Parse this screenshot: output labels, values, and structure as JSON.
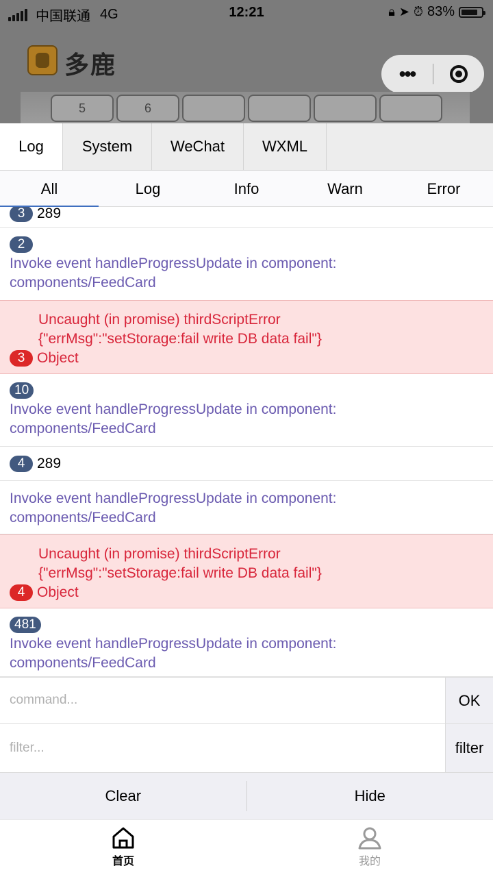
{
  "status_bar": {
    "carrier": "中国联通",
    "network": "4G",
    "time": "12:21",
    "battery_pct": "83%",
    "battery_level": 0.83
  },
  "app": {
    "title": "多鹿"
  },
  "photo_keys": [
    "5",
    "6"
  ],
  "console": {
    "tabs": [
      "Log",
      "System",
      "WeChat",
      "WXML"
    ],
    "active_tab": "Log",
    "subtabs": [
      "All",
      "Log",
      "Info",
      "Warn",
      "Error"
    ],
    "active_subtab": "All",
    "entries": [
      {
        "type": "log",
        "badge": "3",
        "text": "289"
      },
      {
        "type": "info",
        "badge": "2",
        "lines": [
          "Invoke event handleProgressUpdate in component:",
          "components/FeedCard"
        ]
      },
      {
        "type": "error",
        "badge": "3",
        "lines": [
          "Uncaught (in promise) thirdScriptError",
          "{\"errMsg\":\"setStorage:fail write DB data fail\"}",
          "Object"
        ]
      },
      {
        "type": "info",
        "badge": "10",
        "lines": [
          "Invoke event handleProgressUpdate in component:",
          "components/FeedCard"
        ]
      },
      {
        "type": "log",
        "badge": "4",
        "text": "289"
      },
      {
        "type": "info",
        "lines": [
          "Invoke event handleProgressUpdate in component:",
          "components/FeedCard"
        ]
      },
      {
        "type": "error",
        "badge": "4",
        "lines": [
          "Uncaught (in promise) thirdScriptError",
          "{\"errMsg\":\"setStorage:fail write DB data fail\"}",
          "Object"
        ]
      },
      {
        "type": "info",
        "badge": "481",
        "lines": [
          "Invoke event handleProgressUpdate in component:",
          "components/FeedCard"
        ]
      }
    ],
    "command_placeholder": "command...",
    "ok_label": "OK",
    "filter_placeholder": "filter...",
    "filter_label": "filter",
    "clear_label": "Clear",
    "hide_label": "Hide"
  },
  "tabbar": {
    "home_label": "首页",
    "mine_label": "我的"
  },
  "colors": {
    "badge_blue": "#42597f",
    "badge_red": "#dc2727",
    "info_text": "#6b5bb0",
    "error_text": "#d8253a",
    "error_bg": "#fde1e1"
  }
}
